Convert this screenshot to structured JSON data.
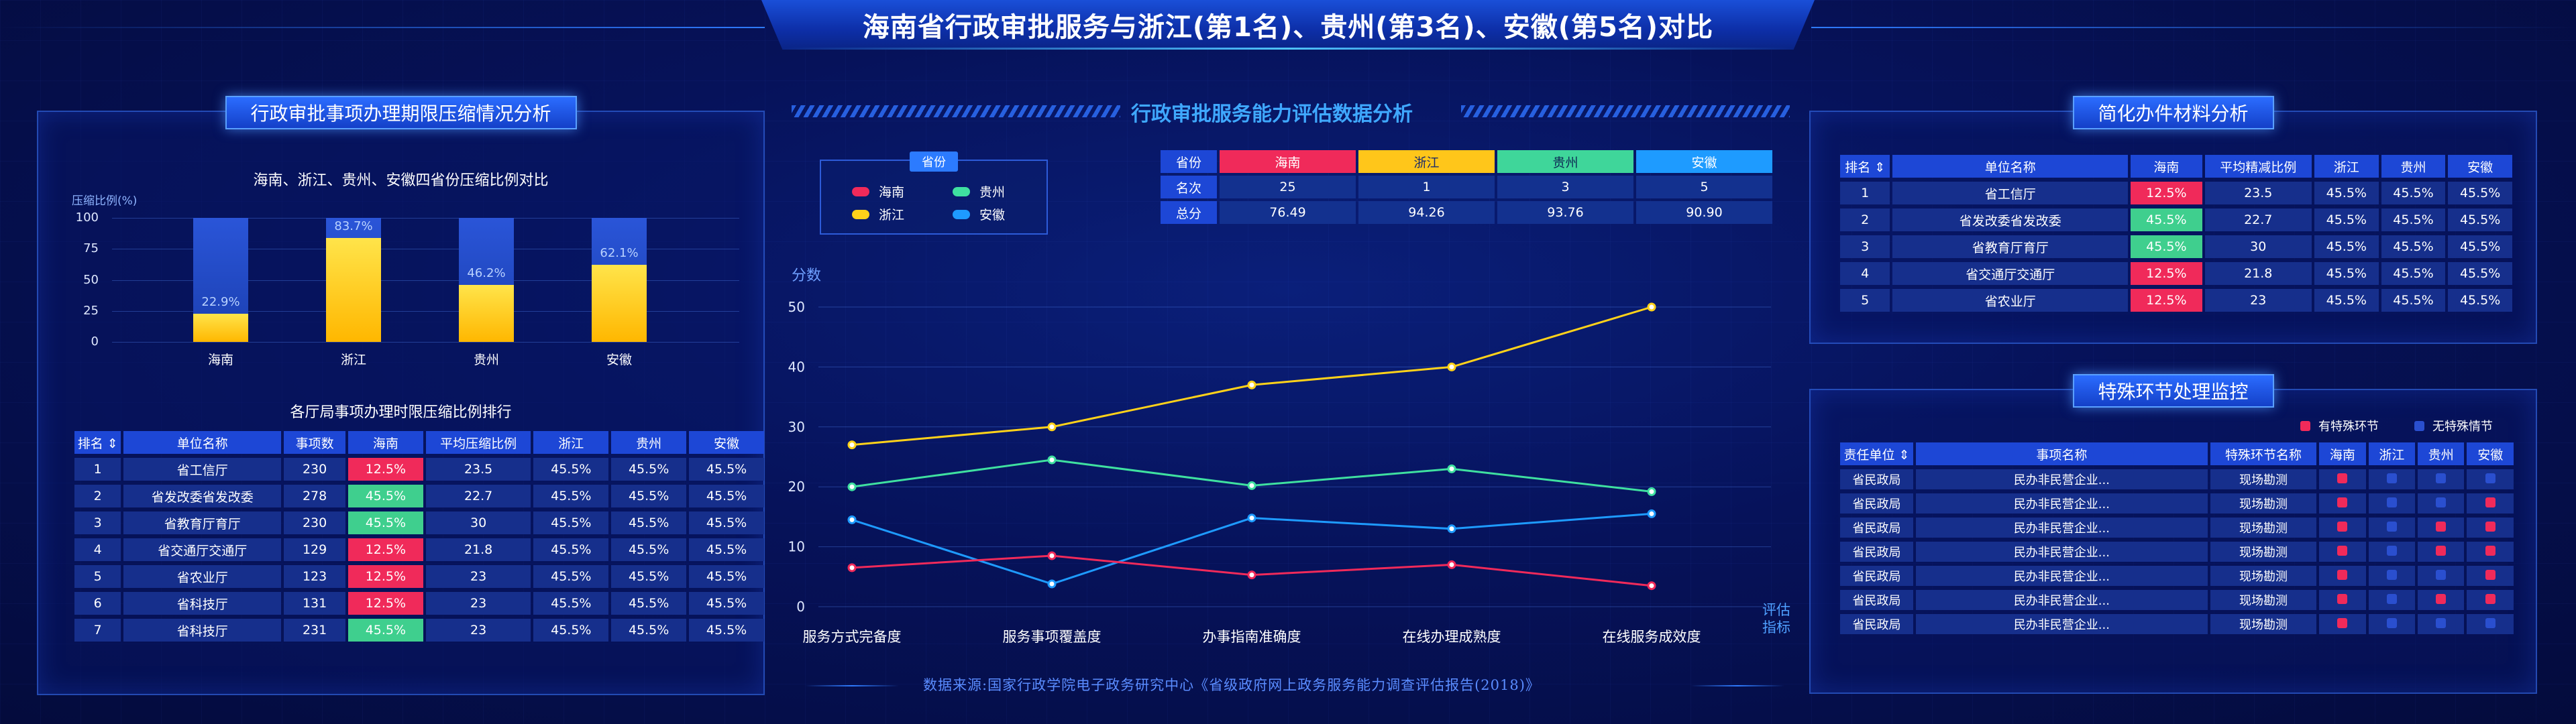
{
  "title": "海南省行政审批服务与浙江(第1名)、贵州(第3名)、安徽(第5名)对比",
  "colors": {
    "hainan": "#f02a5a",
    "zhejiang": "#ffd21a",
    "guizhou": "#3fe0a0",
    "anhui": "#1e9bff"
  },
  "left": {
    "panel_title": "行政审批事项办理期限压缩情况分析",
    "chart_heading": "海南、浙江、贵州、安徽四省份压缩比例对比",
    "table_heading": "各厅局事项办理时限压缩比例排行",
    "chart_data": {
      "type": "bar",
      "ylabel": "压缩比例(%)",
      "ylim": [
        0,
        100
      ],
      "yticks": [
        "100",
        "75",
        "50",
        "25",
        "0"
      ],
      "categories": [
        "海南",
        "浙江",
        "贵州",
        "安徽"
      ],
      "values": [
        22.9,
        83.7,
        46.2,
        62.1
      ],
      "value_labels": [
        "22.9%",
        "83.7%",
        "46.2%",
        "62.1%"
      ]
    },
    "table": {
      "headers": [
        "排名",
        "单位名称",
        "事项数",
        "海南",
        "平均压缩比例",
        "浙江",
        "贵州",
        "安徽"
      ],
      "rows": [
        [
          "1",
          "省工信厅",
          "230",
          "12.5%",
          "23.5",
          "45.5%",
          "45.5%",
          "45.5%"
        ],
        [
          "2",
          "省发改委省发改委",
          "278",
          "45.5%",
          "22.7",
          "45.5%",
          "45.5%",
          "45.5%"
        ],
        [
          "3",
          "省教育厅育厅",
          "230",
          "45.5%",
          "30",
          "45.5%",
          "45.5%",
          "45.5%"
        ],
        [
          "4",
          "省交通厅交通厅",
          "129",
          "12.5%",
          "21.8",
          "45.5%",
          "45.5%",
          "45.5%"
        ],
        [
          "5",
          "省农业厅",
          "123",
          "12.5%",
          "23",
          "45.5%",
          "45.5%",
          "45.5%"
        ],
        [
          "6",
          "省科技厅",
          "131",
          "12.5%",
          "23",
          "45.5%",
          "45.5%",
          "45.5%"
        ],
        [
          "7",
          "省科技厅",
          "231",
          "45.5%",
          "23",
          "45.5%",
          "45.5%",
          "45.5%"
        ]
      ],
      "hainan_status": [
        "red",
        "green",
        "green",
        "red",
        "red",
        "red",
        "green"
      ]
    }
  },
  "middle": {
    "panel_title": "行政审批服务能力评估数据分析",
    "legend_title": "省份",
    "legend": [
      "海南",
      "贵州",
      "浙江",
      "安徽"
    ],
    "rank_table": {
      "provinces": [
        "海南",
        "浙江",
        "贵州",
        "安徽"
      ],
      "row_labels": [
        "省份",
        "名次",
        "总分"
      ],
      "ranks": [
        "25",
        "1",
        "3",
        "5"
      ],
      "scores": [
        "76.49",
        "94.26",
        "93.76",
        "90.90"
      ]
    },
    "chart_data": {
      "type": "line",
      "ylabel": "分数",
      "xlabel": "评估指标",
      "ylim": [
        0,
        50
      ],
      "yticks": [
        "50",
        "40",
        "30",
        "20",
        "10",
        "0"
      ],
      "categories": [
        "服务方式完备度",
        "服务事项覆盖度",
        "办事指南准确度",
        "在线办理成熟度",
        "在线服务成效度"
      ],
      "series": [
        {
          "name": "浙江",
          "values": [
            27,
            30,
            37,
            40,
            50
          ]
        },
        {
          "name": "贵州",
          "values": [
            20,
            24.5,
            20.2,
            23,
            19.2
          ]
        },
        {
          "name": "安徽",
          "values": [
            14.5,
            3.8,
            14.8,
            13,
            15.5
          ]
        },
        {
          "name": "海南",
          "values": [
            6.5,
            8.5,
            5.3,
            7,
            3.5
          ]
        }
      ]
    },
    "footer": "数据来源:国家行政学院电子政务研究中心《省级政府网上政务服务能力调查评估报告(2018)》"
  },
  "right_top": {
    "panel_title": "简化办件材料分析",
    "table": {
      "headers": [
        "排名",
        "单位名称",
        "海南",
        "平均精减比例",
        "浙江",
        "贵州",
        "安徽"
      ],
      "rows": [
        [
          "1",
          "省工信厅",
          "12.5%",
          "23.5",
          "45.5%",
          "45.5%",
          "45.5%"
        ],
        [
          "2",
          "省发改委省发改委",
          "45.5%",
          "22.7",
          "45.5%",
          "45.5%",
          "45.5%"
        ],
        [
          "3",
          "省教育厅育厅",
          "45.5%",
          "30",
          "45.5%",
          "45.5%",
          "45.5%"
        ],
        [
          "4",
          "省交通厅交通厅",
          "12.5%",
          "21.8",
          "45.5%",
          "45.5%",
          "45.5%"
        ],
        [
          "5",
          "省农业厅",
          "12.5%",
          "23",
          "45.5%",
          "45.5%",
          "45.5%"
        ]
      ],
      "hainan_status": [
        "red",
        "green",
        "green",
        "red",
        "red"
      ]
    }
  },
  "right_bottom": {
    "panel_title": "特殊环节处理监控",
    "legend_on": "有特殊环节",
    "legend_off": "无特殊情节",
    "table": {
      "headers": [
        "责任单位",
        "事项名称",
        "特殊环节名称",
        "海南",
        "浙江",
        "贵州",
        "安徽"
      ],
      "rows": [
        [
          "省民政局",
          "民办非民营企业...",
          "现场勘测"
        ],
        [
          "省民政局",
          "民办非民营企业...",
          "现场勘测"
        ],
        [
          "省民政局",
          "民办非民营企业...",
          "现场勘测"
        ],
        [
          "省民政局",
          "民办非民营企业...",
          "现场勘测"
        ],
        [
          "省民政局",
          "民办非民营企业...",
          "现场勘测"
        ],
        [
          "省民政局",
          "民办非民营企业...",
          "现场勘测"
        ],
        [
          "省民政局",
          "民办非民营企业...",
          "现场勘测"
        ]
      ],
      "flags": [
        [
          1,
          0,
          0,
          0
        ],
        [
          1,
          0,
          0,
          1
        ],
        [
          1,
          0,
          1,
          1
        ],
        [
          1,
          0,
          1,
          1
        ],
        [
          1,
          0,
          0,
          1
        ],
        [
          1,
          0,
          1,
          1
        ],
        [
          1,
          0,
          0,
          0
        ]
      ]
    }
  }
}
